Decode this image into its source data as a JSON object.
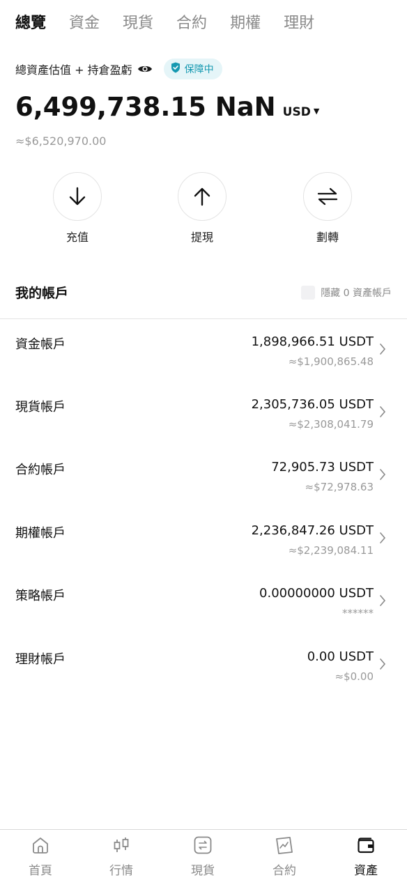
{
  "tabs": [
    {
      "label": "總覽",
      "active": true
    },
    {
      "label": "資金",
      "active": false
    },
    {
      "label": "現貨",
      "active": false
    },
    {
      "label": "合約",
      "active": false
    },
    {
      "label": "期權",
      "active": false
    },
    {
      "label": "理財",
      "active": false
    }
  ],
  "summary": {
    "label": "總資產估值 + 持倉盈虧",
    "badge": "保障中",
    "balance": "6,499,738.15 NaN",
    "currency": "USD",
    "caret": "▼",
    "approx": "≈$6,520,970.00"
  },
  "actions": [
    {
      "label": "充值",
      "icon": "deposit-arrow-down-icon"
    },
    {
      "label": "提現",
      "icon": "withdraw-arrow-up-icon"
    },
    {
      "label": "劃轉",
      "icon": "transfer-icon"
    }
  ],
  "accounts_section": {
    "title": "我的帳戶",
    "hide_zero": "隱藏 0 資產帳戶"
  },
  "accounts": [
    {
      "name": "資金帳戶",
      "amount": "1,898,966.51 USDT",
      "approx": "≈$1,900,865.48"
    },
    {
      "name": "現貨帳戶",
      "amount": "2,305,736.05 USDT",
      "approx": "≈$2,308,041.79"
    },
    {
      "name": "合約帳戶",
      "amount": "72,905.73 USDT",
      "approx": "≈$72,978.63"
    },
    {
      "name": "期權帳戶",
      "amount": "2,236,847.26 USDT",
      "approx": "≈$2,239,084.11"
    },
    {
      "name": "策略帳戶",
      "amount": "0.00000000 USDT",
      "approx": "******"
    },
    {
      "name": "理財帳戶",
      "amount": "0.00 USDT",
      "approx": "≈$0.00"
    }
  ],
  "bottom_nav": [
    {
      "label": "首頁",
      "icon": "home-icon",
      "active": false
    },
    {
      "label": "行情",
      "icon": "candlestick-icon",
      "active": false
    },
    {
      "label": "現貨",
      "icon": "spot-trade-icon",
      "active": false
    },
    {
      "label": "合約",
      "icon": "futures-icon",
      "active": false
    },
    {
      "label": "資產",
      "icon": "wallet-icon",
      "active": true
    }
  ],
  "colors": {
    "accent_teal": "#1699b1",
    "badge_bg": "#e5f5f8",
    "muted_text": "#999999"
  }
}
